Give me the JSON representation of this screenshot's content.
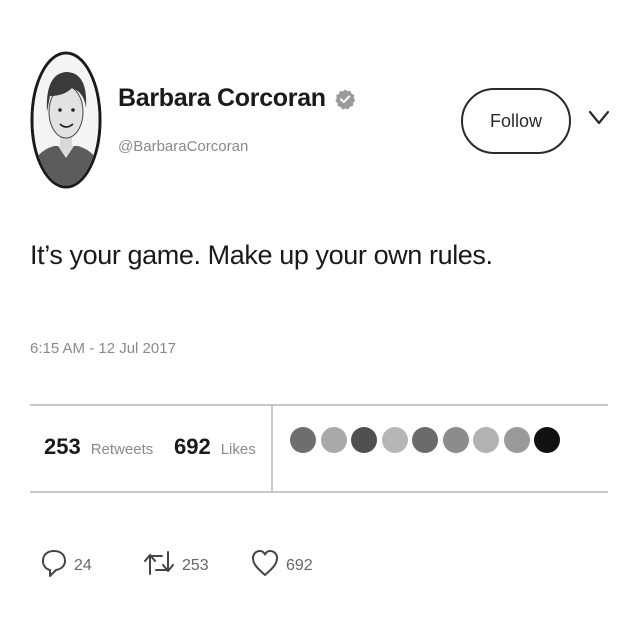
{
  "author": {
    "name": "Barbara Corcoran",
    "handle": "@BarbaraCorcoran",
    "verified_icon": "verified-badge-icon"
  },
  "follow_button": {
    "label": "Follow"
  },
  "menu_icon": "chevron-down-icon",
  "tweet": {
    "text": "It’s your game. Make up your own rules.",
    "timestamp": "6:15 AM - 12 Jul 2017"
  },
  "stats": {
    "retweets": {
      "count": "253",
      "label": "Retweets"
    },
    "likes": {
      "count": "692",
      "label": "Likes"
    }
  },
  "likers": {
    "colors": [
      "#6e6e6e",
      "#a9a9a9",
      "#505050",
      "#b6b6b6",
      "#6a6a6a",
      "#8c8c8c",
      "#b2b2b2",
      "#9a9a9a",
      "#111111"
    ]
  },
  "actions": {
    "reply": {
      "icon": "reply-icon",
      "count": "24"
    },
    "retweet": {
      "icon": "retweet-icon",
      "count": "253"
    },
    "like": {
      "icon": "heart-icon",
      "count": "692"
    }
  }
}
